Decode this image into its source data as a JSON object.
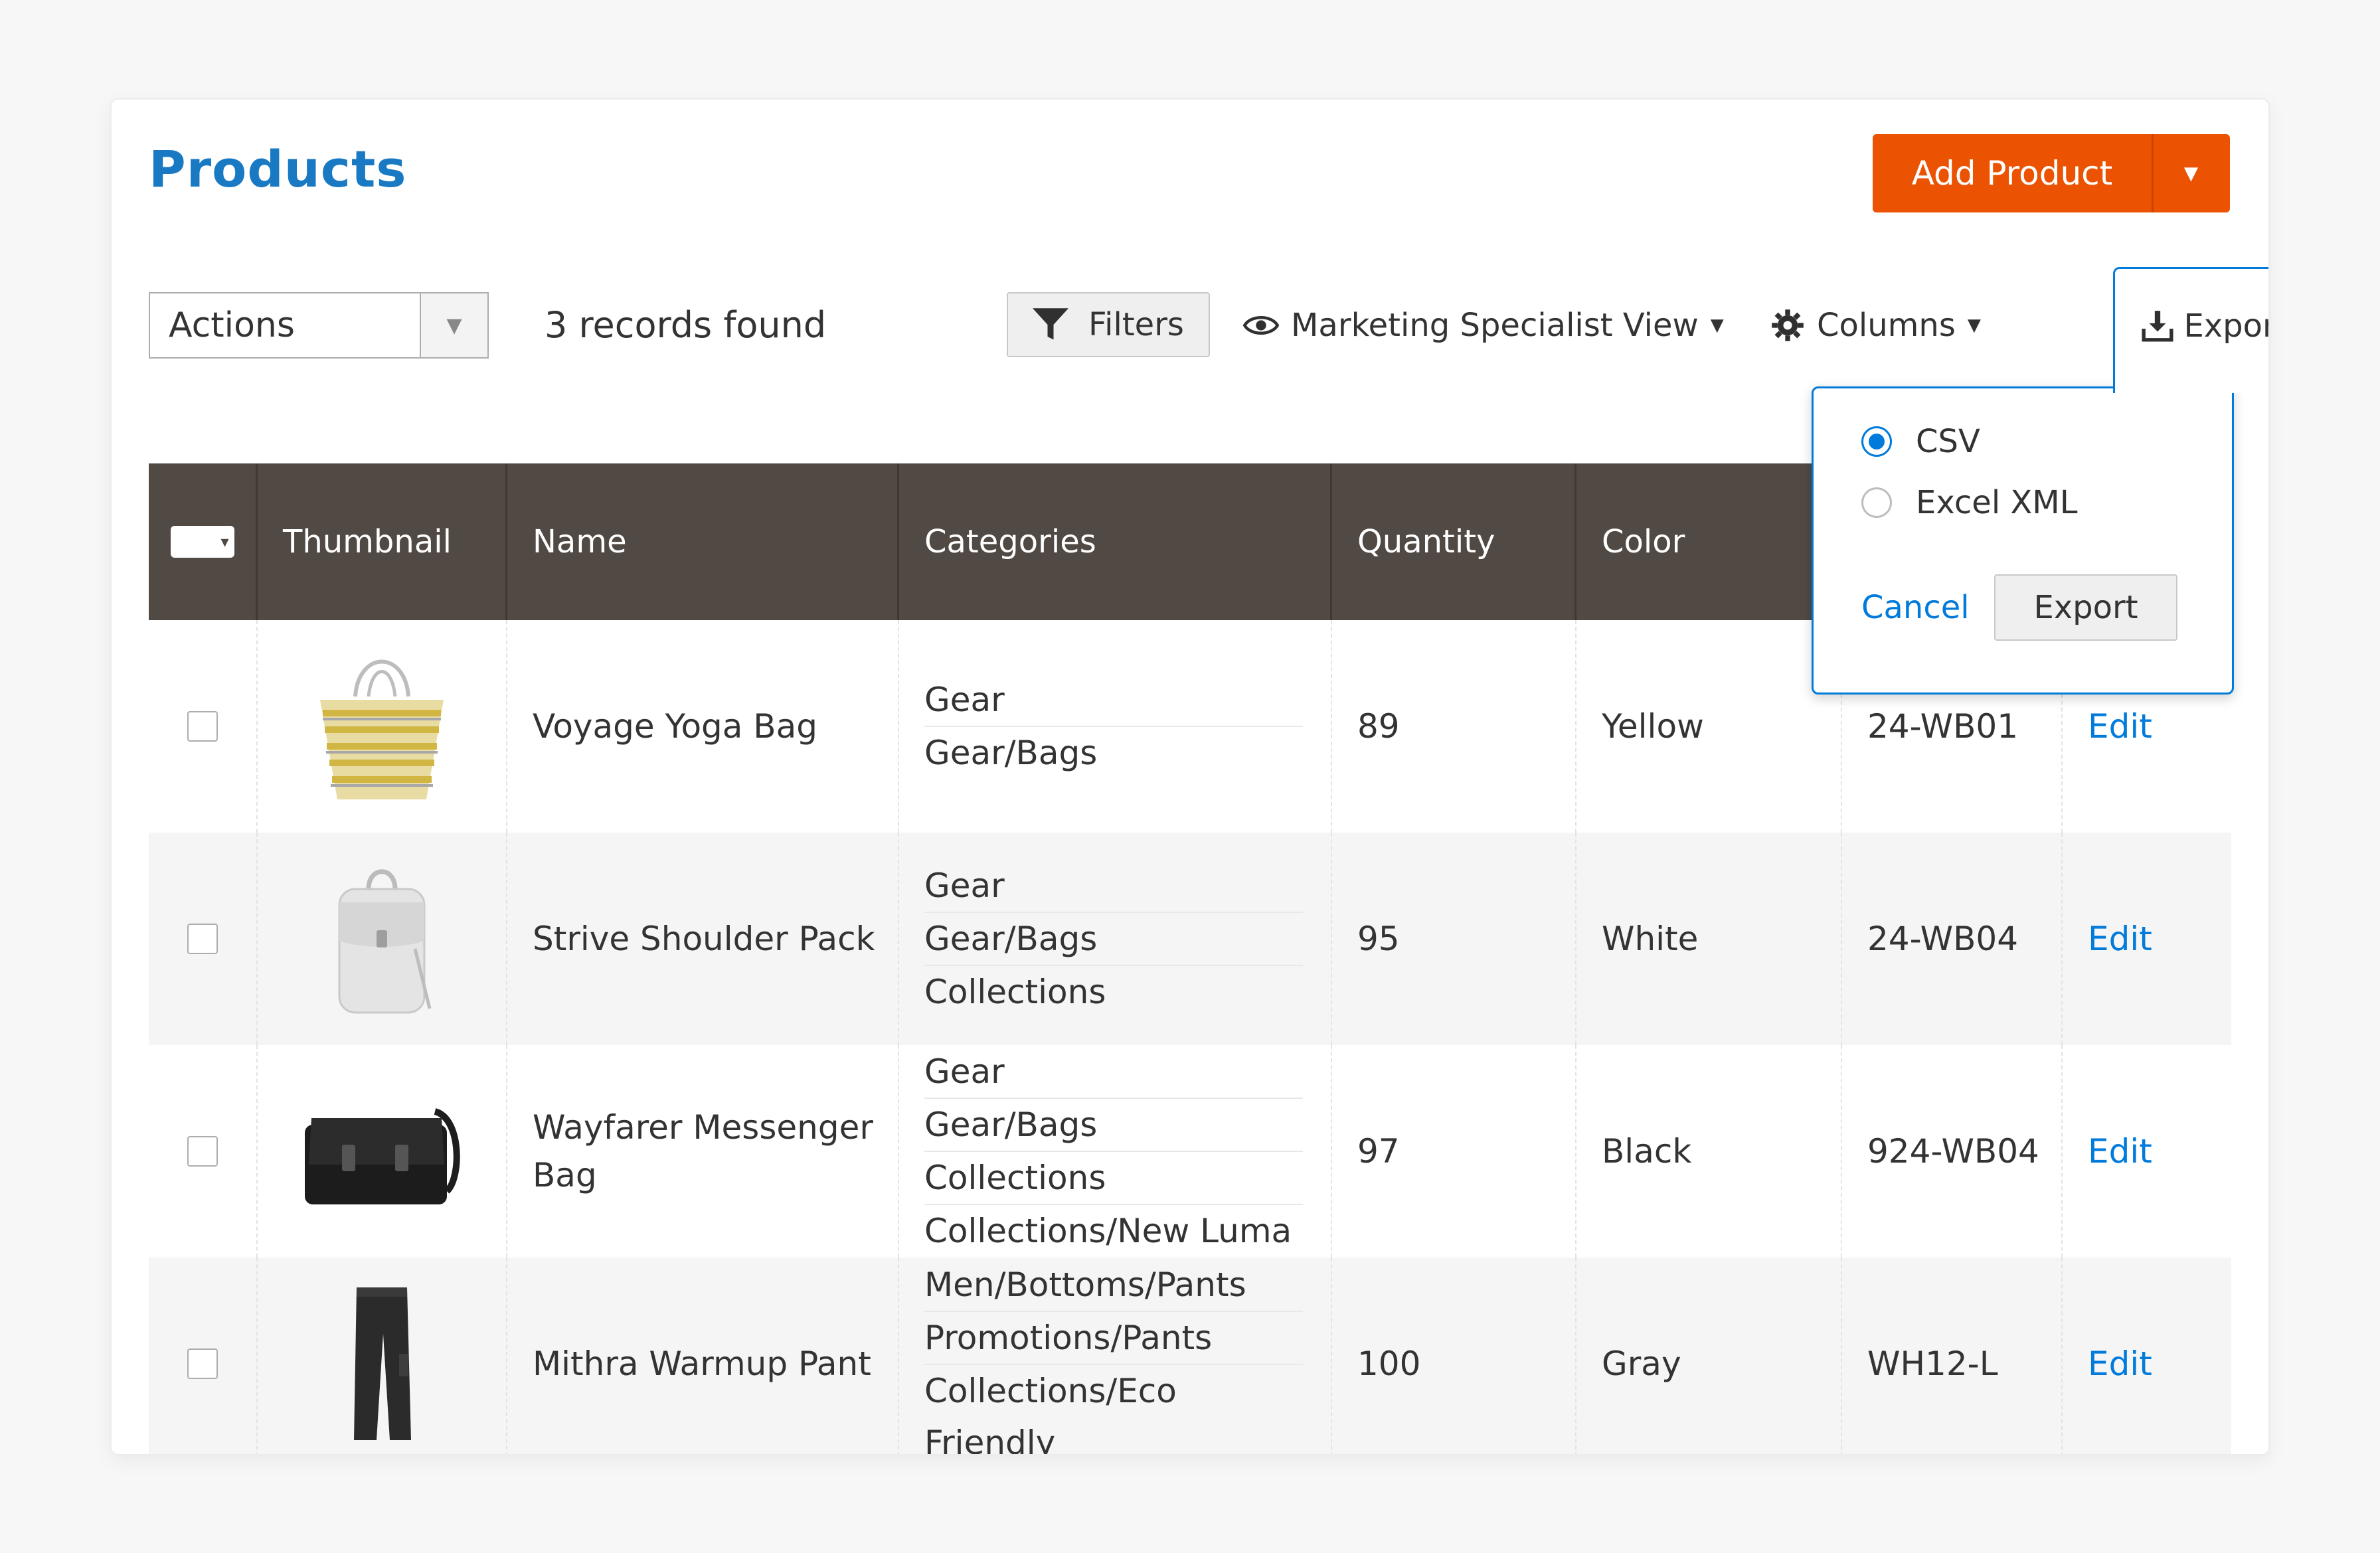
{
  "header": {
    "title": "Products",
    "add_button": "Add Product"
  },
  "toolbar": {
    "actions_label": "Actions",
    "records_found": "3 records found",
    "filters_label": "Filters",
    "view_label": "Marketing Specialist View",
    "columns_label": "Columns",
    "export_label": "Export"
  },
  "export_panel": {
    "options": [
      {
        "label": "CSV",
        "checked": true
      },
      {
        "label": "Excel XML",
        "checked": false
      }
    ],
    "cancel_label": "Cancel",
    "export_button": "Export"
  },
  "table": {
    "columns": [
      "Thumbnail",
      "Name",
      "Categories",
      "Quantity",
      "Color"
    ],
    "rows": [
      {
        "name": "Voyage Yoga Bag",
        "categories": [
          "Gear",
          "Gear/Bags"
        ],
        "quantity": "89",
        "color": "Yellow",
        "sku": "24-WB01",
        "action": "Edit"
      },
      {
        "name": "Strive Shoulder Pack",
        "categories": [
          "Gear",
          "Gear/Bags",
          "Collections"
        ],
        "quantity": "95",
        "color": "White",
        "sku": "24-WB04",
        "action": "Edit"
      },
      {
        "name": "Wayfarer Messenger Bag",
        "categories": [
          "Gear",
          "Gear/Bags",
          "Collections",
          "Collections/New Luma"
        ],
        "quantity": "97",
        "color": "Black",
        "sku": "924-WB04",
        "action": "Edit"
      },
      {
        "name": "Mithra Warmup Pant",
        "categories": [
          "Men/Bottoms/Pants",
          "Promotions/Pants",
          "Collections/Eco Friendly"
        ],
        "quantity": "100",
        "color": "Gray",
        "sku": "WH12-L",
        "action": "Edit"
      }
    ]
  },
  "colors": {
    "brand_blue": "#1979c3",
    "accent_orange": "#eb5202",
    "header_dark": "#514943",
    "link_blue": "#007bdb"
  }
}
